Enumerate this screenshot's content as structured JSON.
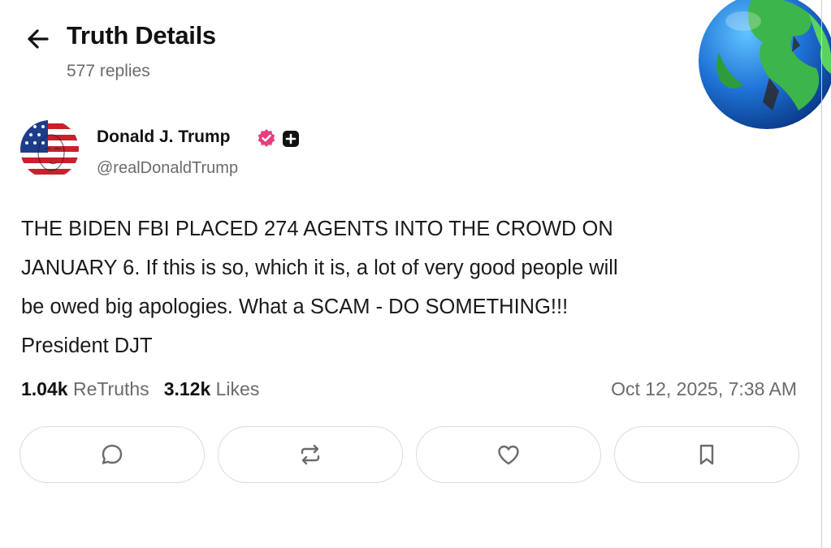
{
  "header": {
    "title": "Truth Details",
    "replies": "577 replies"
  },
  "author": {
    "name": "Donald J. Trump",
    "handle": "@realDonaldTrump",
    "verified_color": "#e5407e"
  },
  "post": {
    "lines": [
      "THE BIDEN FBI PLACED 274 AGENTS INTO THE CROWD ON",
      "JANUARY 6. If this is so, which it is, a lot of very good people will",
      "be owed big apologies. What a SCAM - DO SOMETHING!!!",
      "President DJT"
    ]
  },
  "stats": {
    "retruths_count": "1.04k",
    "retruths_label": "ReTruths",
    "likes_count": "3.12k",
    "likes_label": "Likes",
    "timestamp": "Oct 12, 2025, 7:38 AM"
  },
  "actions": [
    "reply",
    "retruth",
    "like",
    "bookmark"
  ],
  "icons": {
    "back": "arrow-left-icon",
    "verified": "verified-badge-icon",
    "plus": "plus-badge-icon",
    "reply": "comment-icon",
    "retruth": "repost-icon",
    "like": "heart-icon",
    "bookmark": "bookmark-icon"
  }
}
